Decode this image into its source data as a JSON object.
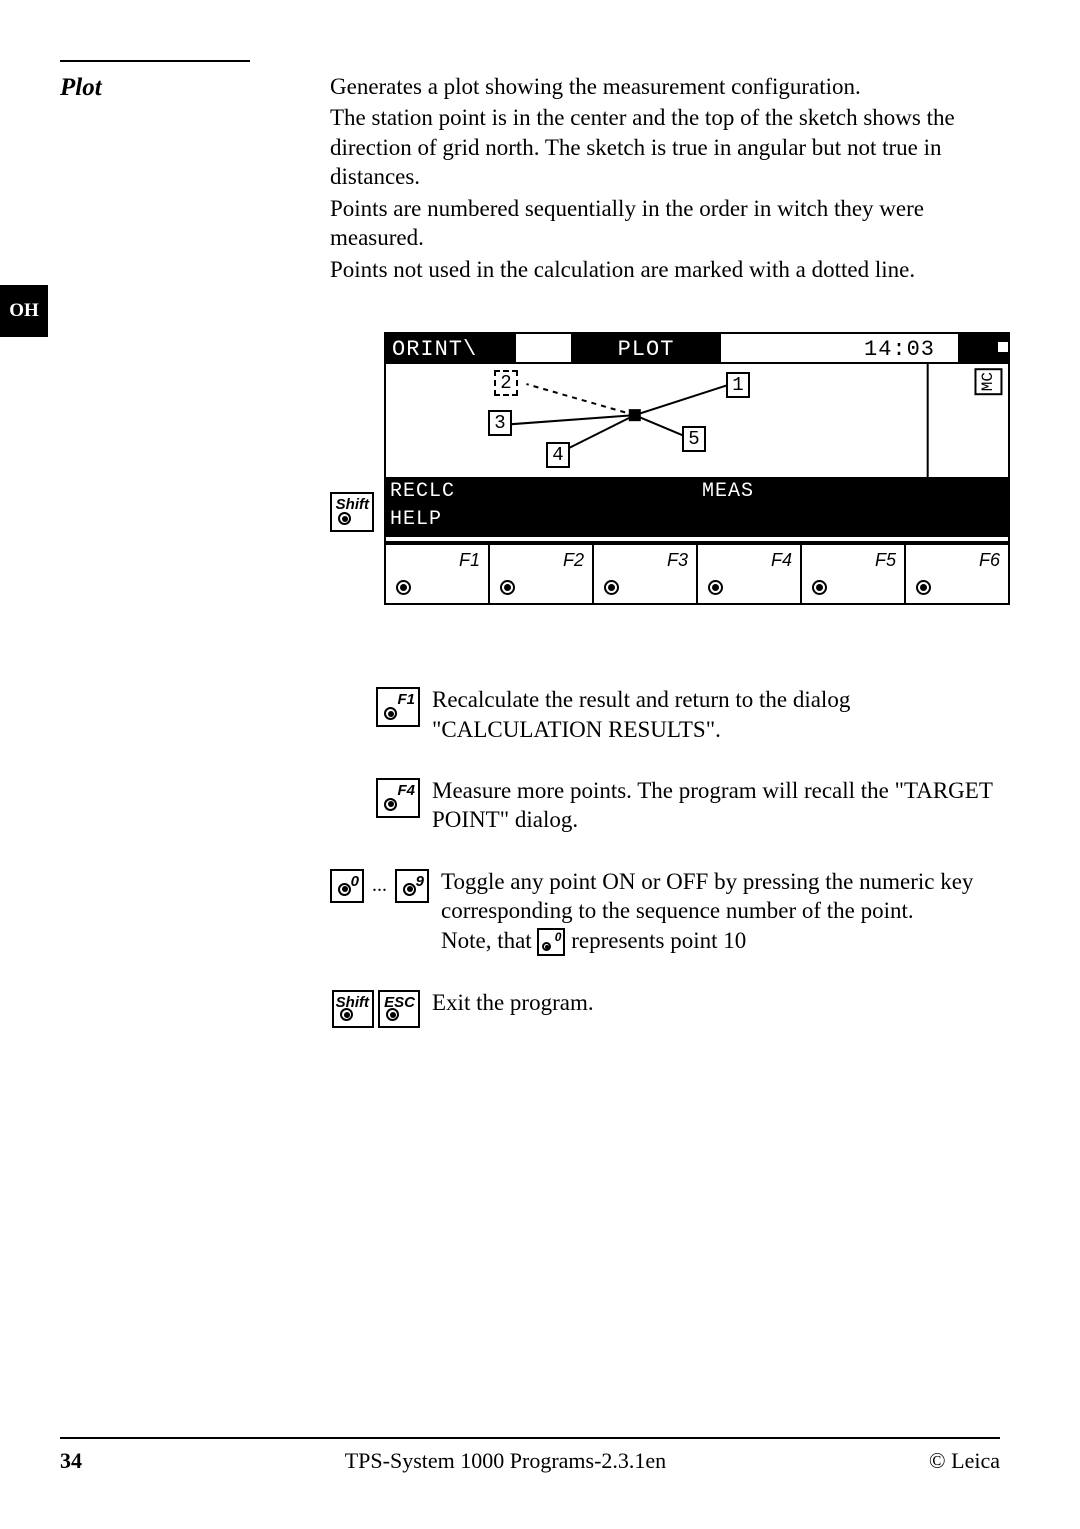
{
  "tab": "OH",
  "section": {
    "heading": "Plot",
    "p1": "Generates a plot showing the measurement configuration.",
    "p2": "The station point is in the center and the top of the sketch shows the direction of grid north. The sketch is true in angular but not true in distances.",
    "p3": "Points are numbered sequentially in the order in witch they were measured.",
    "p4": "Points not used in the calculation are marked with a dotted line."
  },
  "device": {
    "title_left": "ORINT\\",
    "title_center": "PLOT",
    "time": "14:03",
    "mc": "MC",
    "points": {
      "p1": "1",
      "p2": "2",
      "p3": "3",
      "p4": "4",
      "p5": "5"
    },
    "soft_row1": {
      "c1": "RECLC",
      "c2": "",
      "c3": "",
      "c4": "MEAS",
      "c5": "",
      "c6": ""
    },
    "soft_row2": {
      "c1": "HELP",
      "c2": "",
      "c3": "",
      "c4": "",
      "c5": "",
      "c6": ""
    },
    "fkeys": {
      "f1": "F1",
      "f2": "F2",
      "f3": "F3",
      "f4": "F4",
      "f5": "F5",
      "f6": "F6"
    }
  },
  "keys": {
    "shift": "Shift",
    "esc": "ESC",
    "f1": "F1",
    "f4": "F4",
    "n0": "0",
    "n9": "9"
  },
  "desc": {
    "f1": "Recalculate the result and return to the dialog \"CALCULATION RESULTS\".",
    "f4": "Measure more points. The program will recall the \"TARGET POINT\" dialog.",
    "num_a": "Toggle any point ON or OFF by pressing the numeric key corresponding to the sequence number of the point.",
    "num_b1": "Note, that ",
    "num_b2": " represents point 10",
    "exit": "Exit the program."
  },
  "dots": "...",
  "footer": {
    "page": "34",
    "center": "TPS-System 1000 Programs-2.3.1en",
    "right": "© Leica"
  }
}
